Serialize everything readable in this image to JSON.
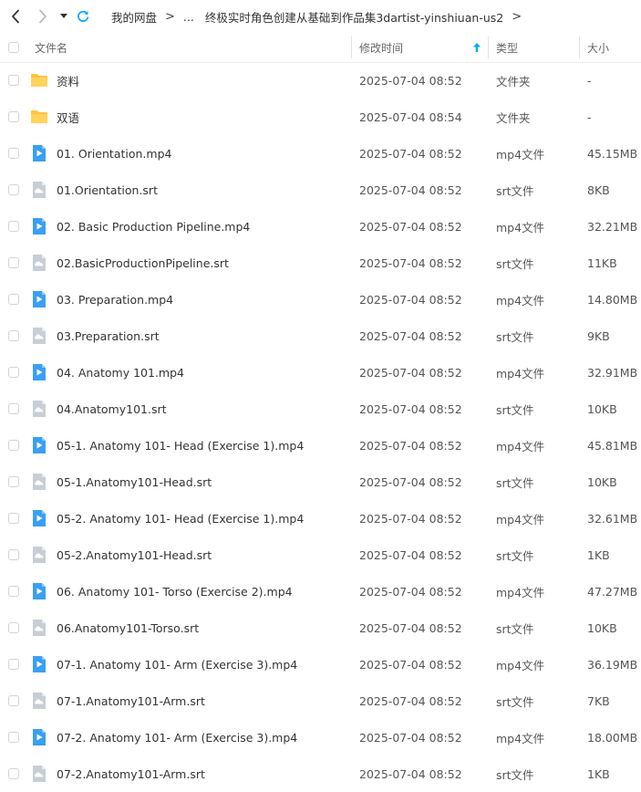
{
  "breadcrumb": {
    "root": "我的网盘",
    "ellipsis": "...",
    "current": "终极实时角色创建从基础到作品集3dartist-yinshiuan-us2",
    "separator": ">"
  },
  "columns": {
    "name": "文件名",
    "modified": "修改时间",
    "type": "类型",
    "size": "大小"
  },
  "colors": {
    "folder": "#ffc53d",
    "video": "#3a9ff5",
    "doc": "#c8ced6",
    "accent": "#06a7ff"
  },
  "files": [
    {
      "name": "资料",
      "date": "2025-07-04 08:52",
      "type": "文件夹",
      "size": "-",
      "icon": "folder-icon"
    },
    {
      "name": "双语",
      "date": "2025-07-04 08:54",
      "type": "文件夹",
      "size": "-",
      "icon": "folder-icon"
    },
    {
      "name": "01. Orientation.mp4",
      "date": "2025-07-04 08:52",
      "type": "mp4文件",
      "size": "45.15MB",
      "icon": "video-file-icon"
    },
    {
      "name": "01.Orientation.srt",
      "date": "2025-07-04 08:52",
      "type": "srt文件",
      "size": "8KB",
      "icon": "subtitle-file-icon"
    },
    {
      "name": "02. Basic Production Pipeline.mp4",
      "date": "2025-07-04 08:52",
      "type": "mp4文件",
      "size": "32.21MB",
      "icon": "video-file-icon"
    },
    {
      "name": "02.BasicProductionPipeline.srt",
      "date": "2025-07-04 08:52",
      "type": "srt文件",
      "size": "11KB",
      "icon": "subtitle-file-icon"
    },
    {
      "name": "03. Preparation.mp4",
      "date": "2025-07-04 08:52",
      "type": "mp4文件",
      "size": "14.80MB",
      "icon": "video-file-icon"
    },
    {
      "name": "03.Preparation.srt",
      "date": "2025-07-04 08:52",
      "type": "srt文件",
      "size": "9KB",
      "icon": "subtitle-file-icon"
    },
    {
      "name": "04. Anatomy 101.mp4",
      "date": "2025-07-04 08:52",
      "type": "mp4文件",
      "size": "32.91MB",
      "icon": "video-file-icon"
    },
    {
      "name": "04.Anatomy101.srt",
      "date": "2025-07-04 08:52",
      "type": "srt文件",
      "size": "10KB",
      "icon": "subtitle-file-icon"
    },
    {
      "name": "05-1. Anatomy 101- Head (Exercise 1).mp4",
      "date": "2025-07-04 08:52",
      "type": "mp4文件",
      "size": "45.81MB",
      "icon": "video-file-icon"
    },
    {
      "name": "05-1.Anatomy101-Head.srt",
      "date": "2025-07-04 08:52",
      "type": "srt文件",
      "size": "10KB",
      "icon": "subtitle-file-icon"
    },
    {
      "name": "05-2. Anatomy 101- Head (Exercise 1).mp4",
      "date": "2025-07-04 08:52",
      "type": "mp4文件",
      "size": "32.61MB",
      "icon": "video-file-icon"
    },
    {
      "name": "05-2.Anatomy101-Head.srt",
      "date": "2025-07-04 08:52",
      "type": "srt文件",
      "size": "1KB",
      "icon": "subtitle-file-icon"
    },
    {
      "name": "06. Anatomy 101- Torso (Exercise 2).mp4",
      "date": "2025-07-04 08:52",
      "type": "mp4文件",
      "size": "47.27MB",
      "icon": "video-file-icon"
    },
    {
      "name": "06.Anatomy101-Torso.srt",
      "date": "2025-07-04 08:52",
      "type": "srt文件",
      "size": "10KB",
      "icon": "subtitle-file-icon"
    },
    {
      "name": "07-1. Anatomy 101- Arm (Exercise 3).mp4",
      "date": "2025-07-04 08:52",
      "type": "mp4文件",
      "size": "36.19MB",
      "icon": "video-file-icon"
    },
    {
      "name": "07-1.Anatomy101-Arm.srt",
      "date": "2025-07-04 08:52",
      "type": "srt文件",
      "size": "7KB",
      "icon": "subtitle-file-icon"
    },
    {
      "name": "07-2. Anatomy 101- Arm (Exercise 3).mp4",
      "date": "2025-07-04 08:52",
      "type": "mp4文件",
      "size": "18.00MB",
      "icon": "video-file-icon"
    },
    {
      "name": "07-2.Anatomy101-Arm.srt",
      "date": "2025-07-04 08:52",
      "type": "srt文件",
      "size": "1KB",
      "icon": "subtitle-file-icon"
    }
  ]
}
